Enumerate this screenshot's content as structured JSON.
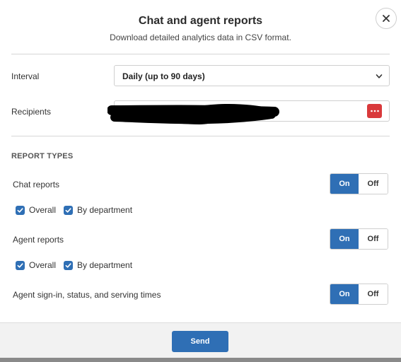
{
  "dialog": {
    "title": "Chat and agent reports",
    "subtitle": "Download detailed analytics data in CSV format."
  },
  "interval": {
    "label": "Interval",
    "value": "Daily (up to 90 days)"
  },
  "recipients": {
    "label": "Recipients"
  },
  "report_types": {
    "heading": "REPORT TYPES",
    "chat": {
      "label": "Chat reports",
      "on_label": "On",
      "off_label": "Off",
      "overall_label": "Overall",
      "by_department_label": "By department"
    },
    "agent": {
      "label": "Agent reports",
      "on_label": "On",
      "off_label": "Off",
      "overall_label": "Overall",
      "by_department_label": "By department"
    },
    "signin": {
      "label": "Agent sign-in, status, and serving times",
      "on_label": "On",
      "off_label": "Off"
    }
  },
  "footer": {
    "send_label": "Send"
  },
  "colors": {
    "accent": "#2f6fb5",
    "dots_button": "#d9393b"
  },
  "icons": {
    "close": "close-icon",
    "select_arrow": "chevron-down-icon",
    "recipients_action": "more-dots-icon",
    "checkbox": "checkmark-icon"
  }
}
